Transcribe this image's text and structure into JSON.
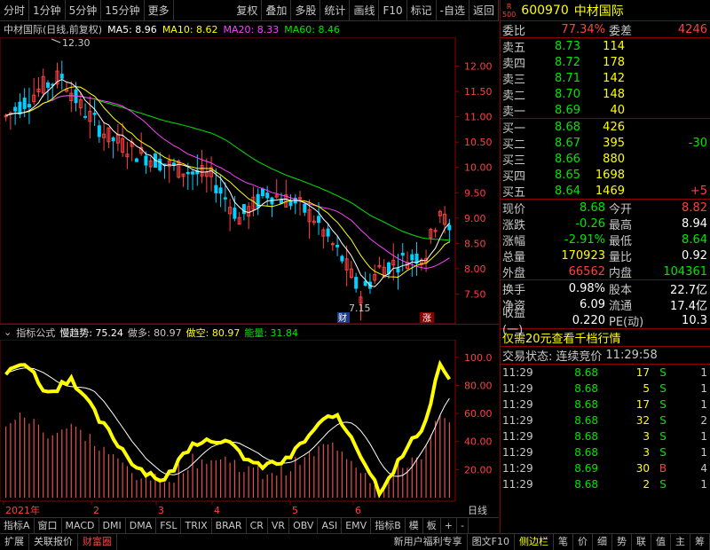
{
  "toolbar": {
    "left_buttons": [
      "分时",
      "1分钟",
      "5分钟",
      "15分钟",
      "更多"
    ],
    "right_buttons": [
      "复权",
      "叠加",
      "多股",
      "统计",
      "画线",
      "F10",
      "标记",
      "-自选",
      "返回"
    ]
  },
  "chart_header": {
    "name": "中材国际(日线,前复权)",
    "ma5": "MA5: 8.96",
    "ma10": "MA10: 8.62",
    "ma20": "MA20: 8.33",
    "ma60": "MA60: 8.46",
    "high_label": "12.30",
    "low_label": "7.15",
    "event_left": "财",
    "event_right": "涨"
  },
  "price_axis": [
    "12.00",
    "11.50",
    "11.00",
    "10.50",
    "10.00",
    "9.50",
    "9.00",
    "8.50",
    "8.00",
    "7.50"
  ],
  "indicator_header": {
    "name": "指标公式",
    "slow": "慢趋势: 75.24",
    "long": "做多: 80.97",
    "short": "做空: 80.97",
    "energy": "能量: 31.84"
  },
  "indicator_axis": [
    "100.0",
    "80.00",
    "60.00",
    "40.00",
    "20.00"
  ],
  "time_axis": {
    "labels": [
      "2021年",
      "2",
      "3",
      "4",
      "5",
      "6"
    ],
    "period": "日线"
  },
  "bottom_tabs": [
    "指标A",
    "窗口",
    "MACD",
    "DMI",
    "DMA",
    "FSL",
    "TRIX",
    "BRAR",
    "CR",
    "VR",
    "OBV",
    "ASI",
    "EMV",
    "指标B",
    "模",
    "板",
    "+",
    "-"
  ],
  "statusbar": {
    "left": [
      "扩展",
      "关联报价",
      "财富圈"
    ],
    "promo": "新用户福利专享",
    "f10": "图文F10",
    "sidebar": "侧边栏",
    "right": [
      "笔",
      "价",
      "细",
      "势",
      "联",
      "值",
      "主",
      "筹"
    ]
  },
  "quote": {
    "code": "600970",
    "name": "中材国际",
    "badge": "R",
    "badge2": "500",
    "webi_label": "委比",
    "webi": "77.34%",
    "weicha_label": "委差",
    "weicha": "4246",
    "asks": [
      {
        "label": "卖五",
        "price": "8.73",
        "vol": "114",
        "chg": ""
      },
      {
        "label": "卖四",
        "price": "8.72",
        "vol": "178",
        "chg": ""
      },
      {
        "label": "卖三",
        "price": "8.71",
        "vol": "142",
        "chg": ""
      },
      {
        "label": "卖二",
        "price": "8.70",
        "vol": "148",
        "chg": ""
      },
      {
        "label": "卖一",
        "price": "8.69",
        "vol": "40",
        "chg": ""
      }
    ],
    "bids": [
      {
        "label": "买一",
        "price": "8.68",
        "vol": "426",
        "chg": ""
      },
      {
        "label": "买二",
        "price": "8.67",
        "vol": "395",
        "chg": "-30"
      },
      {
        "label": "买三",
        "price": "8.66",
        "vol": "880",
        "chg": ""
      },
      {
        "label": "买四",
        "price": "8.65",
        "vol": "1698",
        "chg": ""
      },
      {
        "label": "买五",
        "price": "8.64",
        "vol": "1469",
        "chg": "+5"
      }
    ],
    "stats": [
      {
        "l": "现价",
        "v": "8.68",
        "l2": "今开",
        "v2": "8.82"
      },
      {
        "l": "涨跌",
        "v": "-0.26",
        "l2": "最高",
        "v2": "8.94"
      },
      {
        "l": "涨幅",
        "v": "-2.91%",
        "l2": "最低",
        "v2": "8.64"
      },
      {
        "l": "总量",
        "v": "170923",
        "l2": "量比",
        "v2": "0.92"
      },
      {
        "l": "外盘",
        "v": "66562",
        "l2": "内盘",
        "v2": "104361"
      }
    ],
    "stats2": [
      {
        "l": "换手",
        "v": "0.98%",
        "l2": "股本",
        "v2": "22.7亿"
      },
      {
        "l": "净资",
        "v": "6.09",
        "l2": "流通",
        "v2": "17.4亿"
      },
      {
        "l": "收益(一)",
        "v": "0.220",
        "l2": "PE(动)",
        "v2": "10.3"
      }
    ],
    "promo": "仅需20元查看千档行情",
    "trade_state_label": "交易状态:",
    "trade_state": "连续竞价",
    "trade_time": "11:29:58",
    "ticks": [
      {
        "t": "11:29",
        "p": "8.68",
        "n": "17",
        "d": "S",
        "k": "1"
      },
      {
        "t": "11:29",
        "p": "8.68",
        "n": "5",
        "d": "S",
        "k": "1"
      },
      {
        "t": "11:29",
        "p": "8.68",
        "n": "17",
        "d": "S",
        "k": "1"
      },
      {
        "t": "11:29",
        "p": "8.68",
        "n": "32",
        "d": "S",
        "k": "2"
      },
      {
        "t": "11:29",
        "p": "8.68",
        "n": "3",
        "d": "S",
        "k": "1"
      },
      {
        "t": "11:29",
        "p": "8.68",
        "n": "3",
        "d": "S",
        "k": "1"
      },
      {
        "t": "11:29",
        "p": "8.69",
        "n": "30",
        "d": "B",
        "k": "4"
      },
      {
        "t": "11:29",
        "p": "8.68",
        "n": "2",
        "d": "S",
        "k": "1"
      }
    ]
  },
  "colors": {
    "up": "#ff4040",
    "down": "#00e600",
    "ma5": "#ffffff",
    "ma10": "#ffff00",
    "ma20": "#ff40ff",
    "ma60": "#00e600",
    "frame": "#8b0000"
  }
}
